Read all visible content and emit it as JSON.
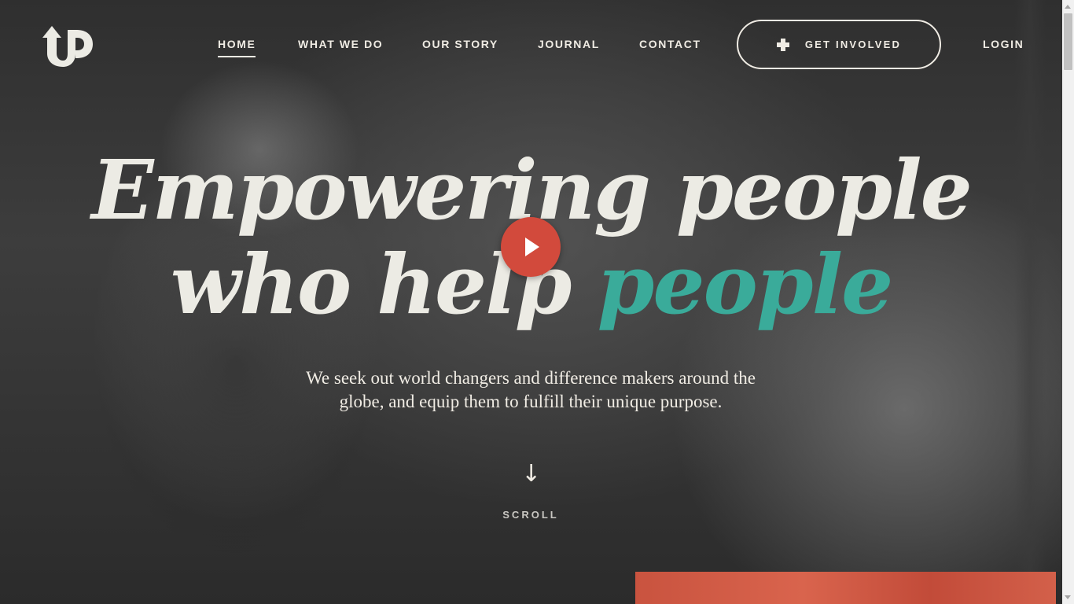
{
  "brand": {
    "logo_text": "UP",
    "logo_icon": "up-arrow-logo-icon"
  },
  "nav": {
    "items": [
      {
        "label": "HOME",
        "active": true
      },
      {
        "label": "WHAT WE DO",
        "active": false
      },
      {
        "label": "OUR STORY",
        "active": false
      },
      {
        "label": "JOURNAL",
        "active": false
      },
      {
        "label": "CONTACT",
        "active": false
      }
    ],
    "cta": {
      "label": "GET INVOLVED",
      "icon": "plus-icon"
    },
    "login": "LOGIN"
  },
  "hero": {
    "headline_line1": "Empowering people",
    "headline_line2_a": "who help ",
    "headline_line2_b": "people",
    "play_icon": "play-icon",
    "subtitle": "We seek out world changers and difference makers around the globe, and equip them to fulfill their unique purpose.",
    "scroll_label": "SCROLL",
    "scroll_icon": "down-arrow-icon"
  },
  "colors": {
    "accent_teal": "#3aab9a",
    "play_red": "#d24a3c",
    "text_light": "#f0ece4"
  }
}
